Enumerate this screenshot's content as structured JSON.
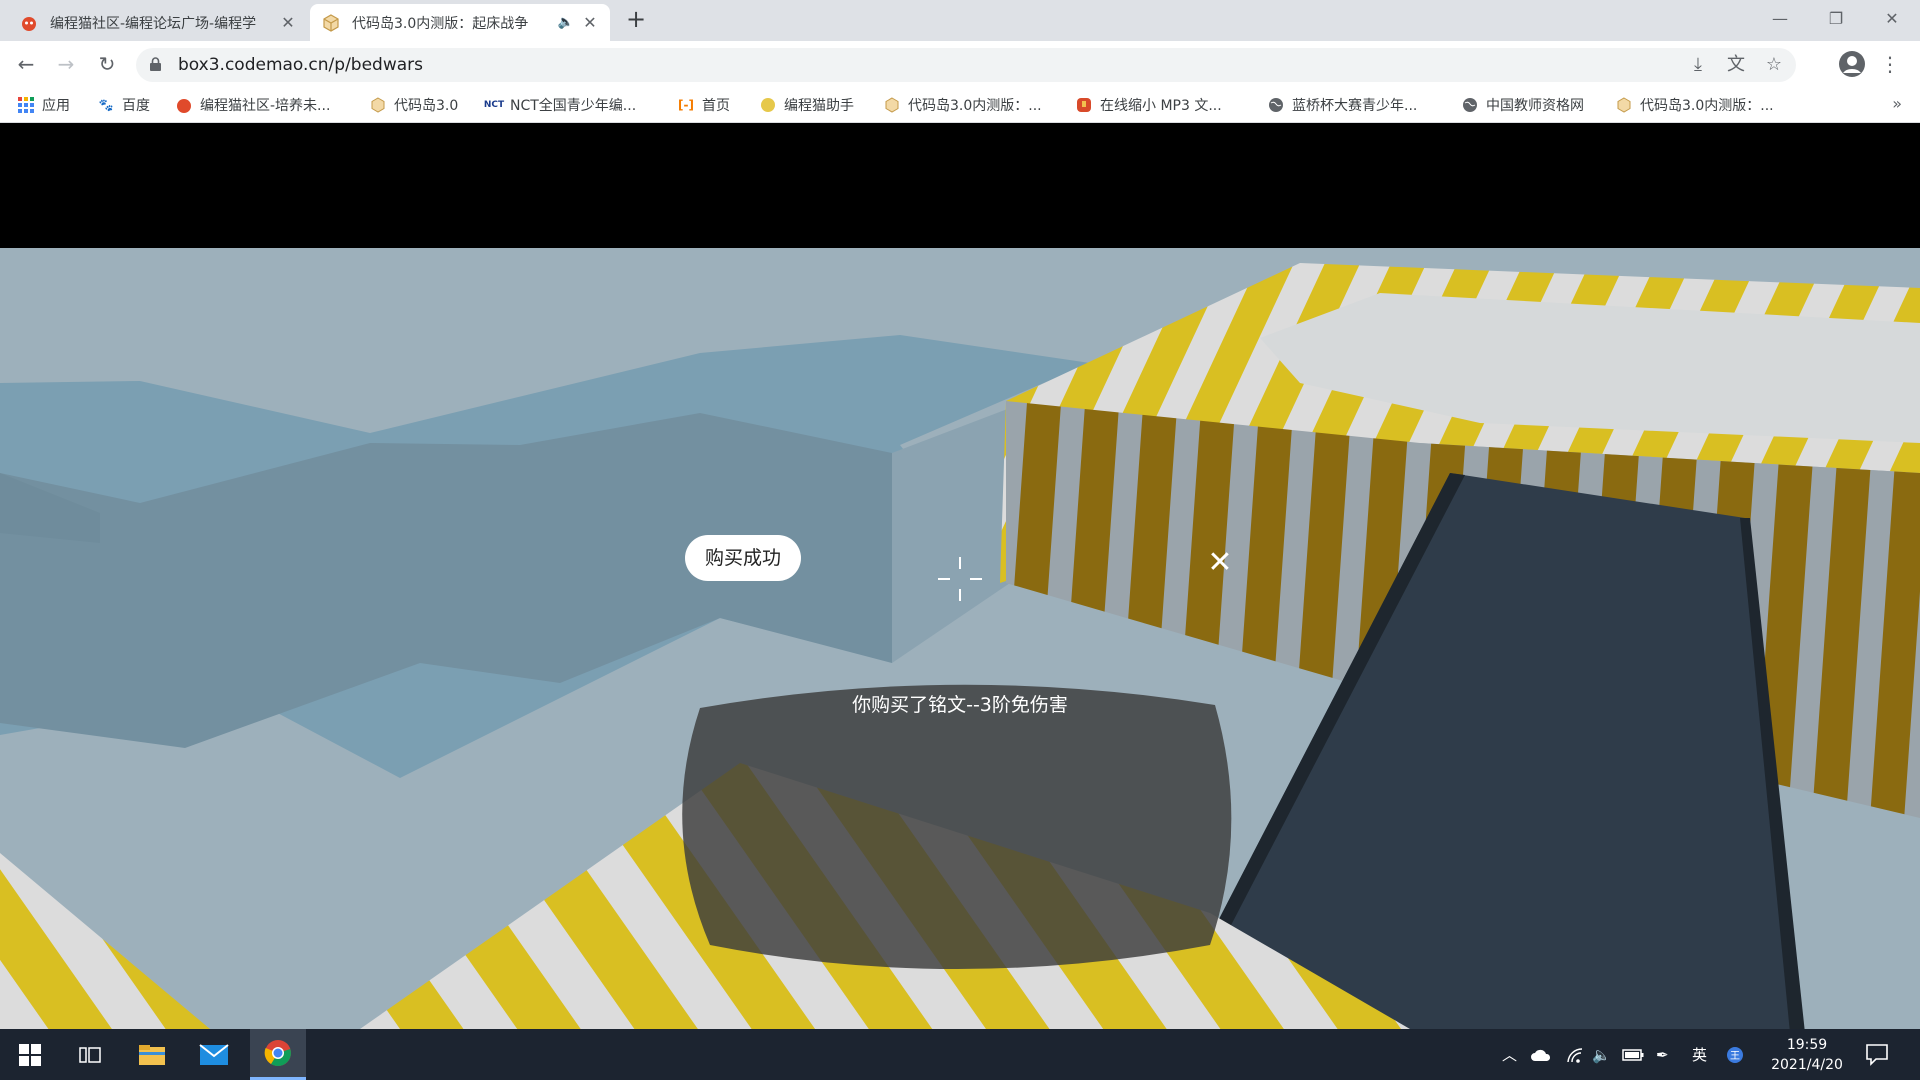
{
  "browser": {
    "tabs": [
      {
        "title": "编程猫社区-编程论坛广场-编程学",
        "active": false
      },
      {
        "title": "代码岛3.0内测版：起床战争",
        "active": true
      }
    ],
    "url": "box3.codemao.cn/p/bedwars",
    "bookmarks": [
      {
        "label": "应用",
        "icon": "apps-grid-icon"
      },
      {
        "label": "百度",
        "icon": "baidu-paw-icon"
      },
      {
        "label": "编程猫社区-培养未...",
        "icon": "codemao-icon"
      },
      {
        "label": "代码岛3.0",
        "icon": "box3-cube-icon"
      },
      {
        "label": "NCT全国青少年编...",
        "icon": "nct-icon"
      },
      {
        "label": "首页",
        "icon": "home-bracket-icon"
      },
      {
        "label": "编程猫助手",
        "icon": "assistant-icon"
      },
      {
        "label": "代码岛3.0内测版：...",
        "icon": "box3-cube-icon"
      },
      {
        "label": "在线缩小 MP3 文...",
        "icon": "mp3-icon"
      },
      {
        "label": "蓝桥杯大赛青少年...",
        "icon": "globe-icon"
      },
      {
        "label": "中国教师资格网",
        "icon": "globe-icon"
      },
      {
        "label": "代码岛3.0内测版：...",
        "icon": "box3-cube-icon"
      }
    ]
  },
  "game": {
    "dialog": {
      "title": "购买成功",
      "message": "你购买了铭文--3阶免伤害",
      "close": "✕"
    }
  },
  "taskbar": {
    "ime": "英",
    "time": "19:59",
    "date": "2021/4/20"
  },
  "colors": {
    "yellow_stripe": "#d9bf22",
    "dark_yellow": "#8a6a10",
    "water": "#7b9fb2",
    "floor": "#9db0bb",
    "dark_panel": "#2f3c4a",
    "dialog_bg": "#3c3c3c"
  }
}
